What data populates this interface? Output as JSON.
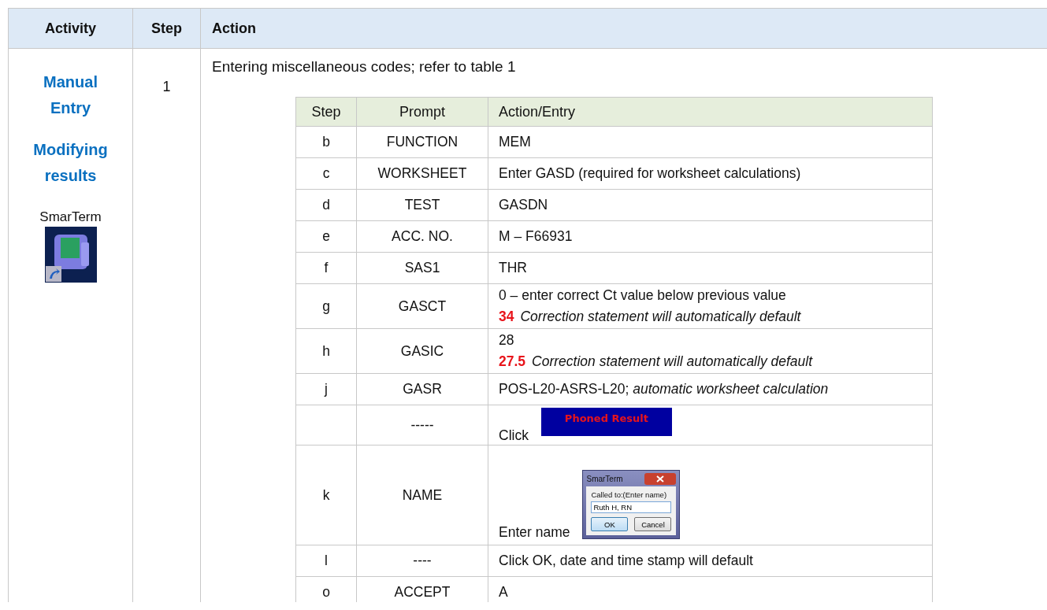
{
  "table": {
    "columns": [
      "Activity",
      "Step",
      "Action"
    ],
    "row": {
      "activity_titles": [
        "Manual Entry",
        "Modifying results"
      ],
      "app_label": "SmarTerm",
      "step": "1",
      "instruction": "Entering miscellaneous codes; refer to table 1",
      "sub_table": {
        "columns": [
          "Step",
          "Prompt",
          "Action/Entry"
        ],
        "rows": [
          {
            "step": "b",
            "prompt": "FUNCTION",
            "kind": "text",
            "action": "MEM"
          },
          {
            "step": "c",
            "prompt": "WORKSHEET",
            "kind": "text",
            "action": "Enter GASD (required for worksheet calculations)"
          },
          {
            "step": "d",
            "prompt": "TEST",
            "kind": "text",
            "action": "GASDN"
          },
          {
            "step": "e",
            "prompt": "ACC. NO.",
            "kind": "text",
            "action": "M – F66931"
          },
          {
            "step": "f",
            "prompt": "SAS1",
            "kind": "text",
            "action": "THR"
          },
          {
            "step": "g",
            "prompt": "GASCT",
            "kind": "correction",
            "action": "0 – enter correct Ct value below previous value",
            "value": "34",
            "note": "Correction statement will automatically default"
          },
          {
            "step": "h",
            "prompt": "GASIC",
            "kind": "correction",
            "action": "28",
            "value": "27.5",
            "note": "Correction statement will automatically default"
          },
          {
            "step": "j",
            "prompt": "GASR",
            "kind": "text",
            "action": "POS-L20-ASRS-L20; *automatic worksheet calculation*"
          },
          {
            "step": "",
            "prompt": "-----",
            "kind": "button",
            "action": "Click",
            "button": "Phoned Result"
          },
          {
            "step": "k",
            "prompt": "NAME",
            "kind": "dialog",
            "action": "Enter name",
            "dialog": {
              "title": "SmarTerm",
              "label": "Called to:(Enter name)",
              "value": "Ruth H, RN",
              "buttons": [
                "OK",
                "Cancel"
              ]
            }
          },
          {
            "step": "l",
            "prompt": "----",
            "kind": "text",
            "action": "Click OK, date and time stamp will default"
          },
          {
            "step": "o",
            "prompt": "ACCEPT",
            "kind": "text",
            "action": "A"
          }
        ]
      }
    }
  }
}
